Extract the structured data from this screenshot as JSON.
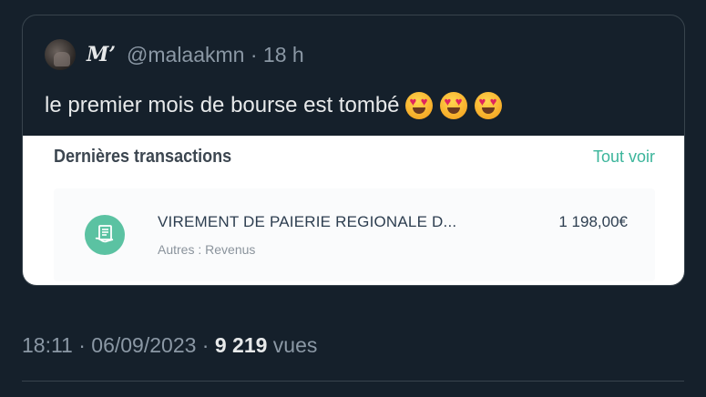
{
  "quote": {
    "display_name": "M’",
    "handle_time": "@malaakmn · 18 h",
    "text": "le premier mois de bourse est tombé"
  },
  "transactions": {
    "title": "Dernières transactions",
    "see_all": "Tout voir",
    "items": [
      {
        "label": "VIREMENT DE  PAIERIE REGIONALE D...",
        "category": "Autres : Revenus",
        "amount": "1 198,00€"
      }
    ]
  },
  "meta": {
    "time_date": "18:11 · 06/09/2023 · ",
    "views_count": "9 219",
    "views_label": " vues"
  },
  "colors": {
    "background": "#15202b",
    "accent": "#3bb59b",
    "icon_bg": "#5bc2a2"
  }
}
